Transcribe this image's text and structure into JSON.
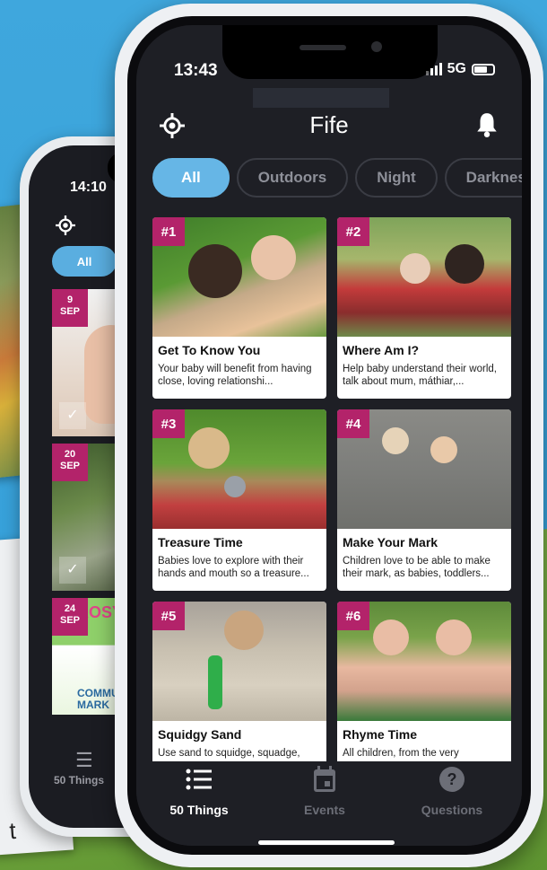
{
  "back_phone": {
    "time": "14:10",
    "filter_all": "All",
    "cards": [
      {
        "day": "9",
        "month": "SEP"
      },
      {
        "day": "20",
        "month": "SEP"
      },
      {
        "day": "24",
        "month": "SEP",
        "sign_top": "ROSY",
        "sign_bottom": "COMMU MARK"
      }
    ],
    "nav_label": "50 Things"
  },
  "background_text": "t",
  "status": {
    "time": "13:43",
    "network": "5G"
  },
  "header": {
    "title": "Fife"
  },
  "filters": [
    "All",
    "Outdoors",
    "Night",
    "Darknes"
  ],
  "cards": [
    {
      "num": "#1",
      "title": "Get To Know You",
      "desc": "Your baby will benefit from having close, loving relationshi..."
    },
    {
      "num": "#2",
      "title": "Where Am I?",
      "desc": "Help baby understand their world, talk about mum, máthiar,..."
    },
    {
      "num": "#3",
      "title": "Treasure Time",
      "desc": "Babies love to explore with their hands and mouth so a treasure..."
    },
    {
      "num": "#4",
      "title": "Make Your Mark",
      "desc": "Children love to be able to make their mark, as babies, toddlers..."
    },
    {
      "num": "#5",
      "title": "Squidgy Sand",
      "desc": "Use sand to squidge, squadge,"
    },
    {
      "num": "#6",
      "title": "Rhyme Time",
      "desc": "All children, from the very"
    }
  ],
  "tabs": [
    {
      "label": "50 Things",
      "icon": "list-icon",
      "active": true
    },
    {
      "label": "Events",
      "icon": "calendar-icon",
      "active": false
    },
    {
      "label": "Questions",
      "icon": "question-icon",
      "active": false
    }
  ],
  "colors": {
    "accent": "#66b6e6",
    "badge": "#b3236a",
    "background": "#1e1f25"
  }
}
